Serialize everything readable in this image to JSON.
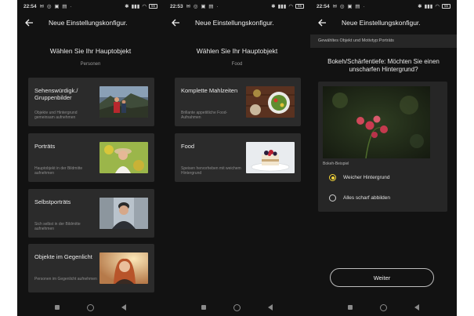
{
  "screens": [
    {
      "status": {
        "time": "22:54",
        "icons": "✉ ◎ ▣ ▤ ·",
        "battery": "55"
      },
      "title": "Neue Einstellungskonfigur.",
      "heading": "Wählen Sie Ihr Hauptobjekt",
      "subheading": "Personen",
      "cards": [
        {
          "title": "Sehenswürdigk./ Gruppenbilder",
          "desc": "Objekte und Hintergrund gemeinsam aufnehmen",
          "image": "group-landscape-photo"
        },
        {
          "title": "Porträts",
          "desc": "Hauptobjekt in der Bildmitte aufnehmen",
          "image": "portrait-photo"
        },
        {
          "title": "Selbstporträts",
          "desc": "Sich selbst in der Bildmitte aufnehmen",
          "image": "selfie-photo"
        },
        {
          "title": "Objekte im Gegenlicht",
          "desc": "Personen im Gegenlicht aufnehmen",
          "image": "backlight-portrait-photo"
        }
      ]
    },
    {
      "status": {
        "time": "22:53",
        "icons": "✉ ◎ ▣ ▤ ·",
        "battery": "55"
      },
      "title": "Neue Einstellungskonfigur.",
      "heading": "Wählen Sie Ihr Hauptobjekt",
      "subheading": "Food",
      "cards": [
        {
          "title": "Komplette Mahlzeiten",
          "desc": "Brillante appetitliche Food-Aufnahmen",
          "image": "meal-photo"
        },
        {
          "title": "Food",
          "desc": "Speisen hervorheben mit weichem Hintergrund",
          "image": "dessert-photo"
        }
      ]
    },
    {
      "status": {
        "time": "22:54",
        "icons": "✉ ◎ ▣ ▤ ·",
        "battery": "55"
      },
      "title": "Neue Einstellungskonfigur.",
      "selected": "Gewähltes Objekt und Motivtyp:Porträts",
      "question": "Bokeh/Schärfentiefe: Möchten Sie einen unscharfen Hintergrund?",
      "example_label": "Bokeh-Beispiel",
      "options": [
        {
          "label": "Weicher Hintergrund",
          "checked": true
        },
        {
          "label": "Alles scharf abbilden",
          "checked": false
        }
      ],
      "next_label": "Weiter"
    }
  ],
  "colors": {
    "background": "#121212",
    "card": "#2b2b2b",
    "accent": "#f3d43a"
  }
}
